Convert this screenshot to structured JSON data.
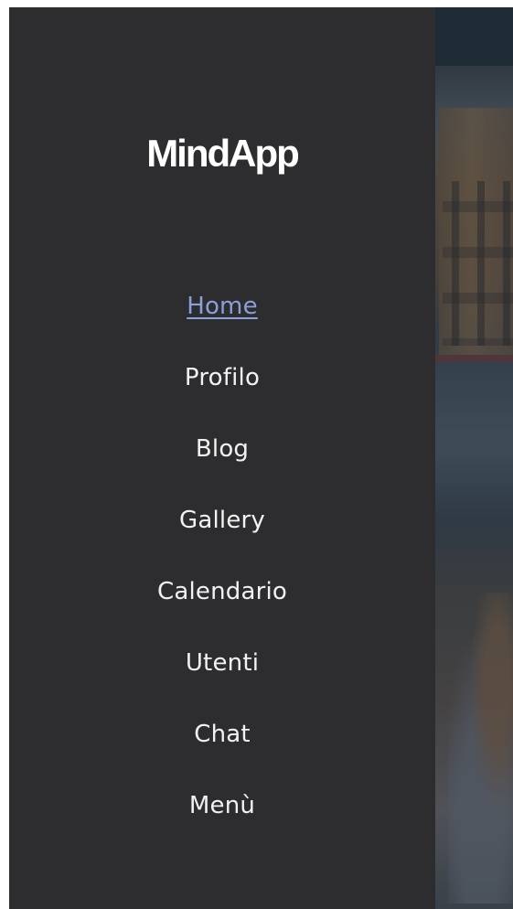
{
  "app": {
    "brand": "MindApp"
  },
  "nav": {
    "items": [
      {
        "label": "Home",
        "active": true
      },
      {
        "label": "Profilo",
        "active": false
      },
      {
        "label": "Blog",
        "active": false
      },
      {
        "label": "Gallery",
        "active": false
      },
      {
        "label": "Calendario",
        "active": false
      },
      {
        "label": "Utenti",
        "active": false
      },
      {
        "label": "Chat",
        "active": false
      },
      {
        "label": "Menù",
        "active": false
      }
    ]
  },
  "colors": {
    "drawer_bg": "#2d2d30",
    "active_link": "#8b9fd8",
    "link": "#f2f2f2"
  }
}
